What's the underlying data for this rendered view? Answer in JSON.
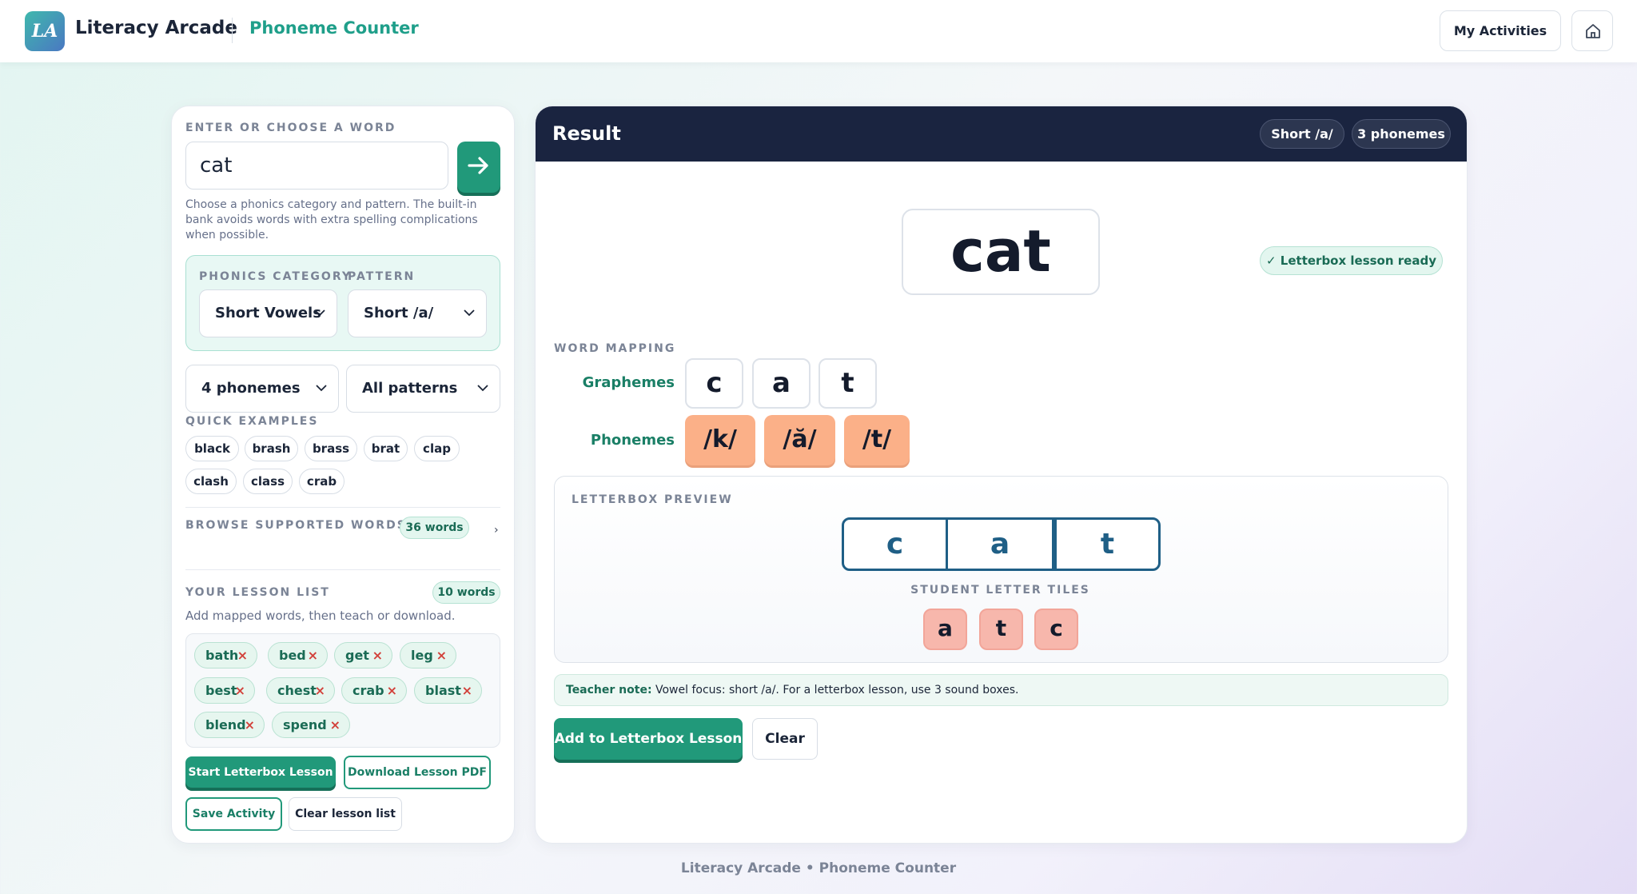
{
  "header": {
    "logo_text": "LA",
    "brand": "Literacy Arcade",
    "app_name": "Phoneme Counter",
    "my_activities": "My Activities",
    "home_icon": "home-icon"
  },
  "left": {
    "word_label": "ENTER OR CHOOSE A WORD",
    "word_value": "cat",
    "helper": "Choose a phonics category and pattern. The built-in bank avoids words with extra spelling complications when possible.",
    "category_label": "PHONICS CATEGORY",
    "pattern_label": "PATTERN",
    "category_value": "Short Vowels",
    "pattern_value": "Short /a/",
    "phoneme_filter": "4 phonemes",
    "pattern_filter": "All patterns",
    "quick_label": "QUICK EXAMPLES",
    "quick_examples": [
      "black",
      "brash",
      "brass",
      "brat",
      "clap",
      "clash",
      "class",
      "crab"
    ],
    "browse_label": "BROWSE SUPPORTED WORDS",
    "browse_count": "36 words",
    "lesson_label": "YOUR LESSON LIST",
    "lesson_count": "10 words",
    "lesson_help": "Add mapped words, then teach or download.",
    "lesson_words": [
      "bath",
      "bed",
      "get",
      "leg",
      "best",
      "chest",
      "crab",
      "blast",
      "blend",
      "spend"
    ],
    "remove_symbol": "×",
    "start_lesson": "Start Letterbox Lesson",
    "download_pdf": "Download Lesson PDF",
    "save_activity": "Save Activity",
    "clear_list": "Clear lesson list"
  },
  "result": {
    "title": "Result",
    "pattern_pill": "Short /a/",
    "phoneme_pill": "3 phonemes",
    "word": "cat",
    "ready_badge": "✓ Letterbox lesson ready",
    "mapping_label": "WORD MAPPING",
    "graphemes_label": "Graphemes",
    "phonemes_label": "Phonemes",
    "graphemes": [
      "c",
      "a",
      "t"
    ],
    "phonemes": [
      "/k/",
      "/ă/",
      "/t/"
    ],
    "preview_label": "LETTERBOX PREVIEW",
    "letterbox": [
      "c",
      "a",
      "t"
    ],
    "tiles_label": "STUDENT LETTER TILES",
    "student_tiles": [
      "a",
      "t",
      "c"
    ],
    "teacher_note_label": "Teacher note:",
    "teacher_note": " Vowel focus: short /a/. For a letterbox lesson, use 3 sound boxes.",
    "add_button": "Add to Letterbox Lesson",
    "clear_button": "Clear"
  },
  "footer": "Literacy Arcade • Phoneme Counter",
  "colors": {
    "accent_green": "#21997a",
    "teal_text": "#1f9f8a",
    "navy_header": "#1a2440",
    "phoneme_tile": "#fbb088",
    "student_tile": "#f7b7ac",
    "letterbox_border": "#1f5f86"
  }
}
